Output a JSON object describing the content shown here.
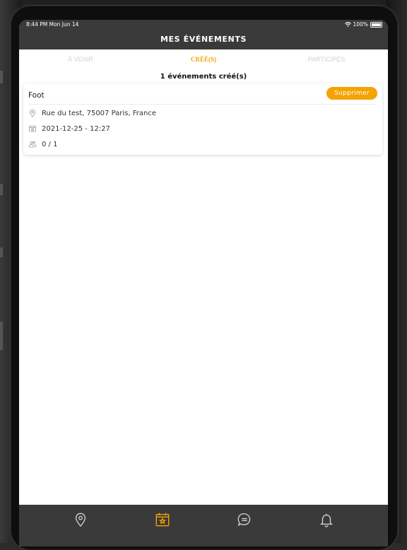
{
  "status_bar": {
    "time": "8:44 PM  Mon Jun 14",
    "battery": "100%"
  },
  "header": {
    "title": "MES ÉVÉNEMENTS"
  },
  "tabs": [
    {
      "label": "À VENIR",
      "active": false
    },
    {
      "label": "CRÉÉ(S)",
      "active": true
    },
    {
      "label": "PARTICIPÉS",
      "active": false
    }
  ],
  "summary": {
    "count_text": "1 événements créé(s)"
  },
  "events": [
    {
      "name": "Foot",
      "delete_label": "Supprimer",
      "address": "Rue du test, 75007 Paris, France",
      "datetime": "2021-12-25 - 12:27",
      "participants": "0 / 1"
    }
  ],
  "nav": [
    {
      "icon": "location-pin-icon",
      "active": false
    },
    {
      "icon": "calendar-star-icon",
      "active": true
    },
    {
      "icon": "chat-bubble-icon",
      "active": false
    },
    {
      "icon": "bell-icon",
      "active": false
    }
  ],
  "colors": {
    "accent": "#f4a300",
    "bar": "#3a3a3a"
  }
}
